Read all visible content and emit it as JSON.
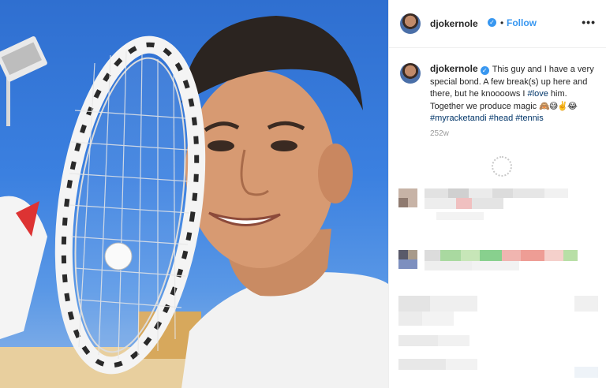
{
  "post": {
    "username": "djokernole",
    "follow_label": "Follow",
    "separator": "•",
    "more_label": "•••",
    "verified_mark": "✓",
    "caption_body": "This guy and I have a very special bond. A few break(s) up here and there, but he knoooows I ",
    "caption_tag_love": "#love",
    "caption_mid": " him. Together we produce magic ",
    "caption_emojis": "🙈😅✌️😂",
    "caption_tag_racket": "#myracketandi",
    "caption_tag_head": "#head",
    "caption_tag_tennis": "#tennis",
    "age": "252w"
  },
  "icons": {
    "verified": "verified-badge-icon",
    "more": "more-options-icon",
    "loading": "loading-spinner-icon"
  },
  "colors": {
    "accent": "#3897f0",
    "hashtag": "#003569",
    "text": "#262626",
    "muted": "#999999",
    "sky": "#3b80e0"
  }
}
